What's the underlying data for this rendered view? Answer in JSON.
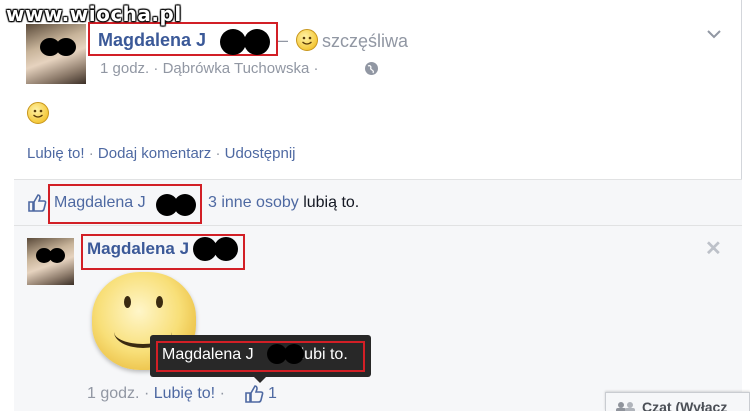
{
  "watermark": "www.wiocha.pl",
  "post": {
    "author": "Magdalena J",
    "feeling_dash": "–",
    "feeling": "szczęśliwa",
    "time": "1 godz.",
    "separator": "·",
    "location": "Dąbrówka Tuchowska",
    "location_sep": "·",
    "actions": {
      "like": "Lubię to!",
      "comment": "Dodaj komentarz",
      "share": "Udostępnij",
      "sep": "·"
    }
  },
  "likes": {
    "name": "Magdalena J",
    "others": "3 inne osoby",
    "suffix": "lubią to."
  },
  "comment": {
    "author": "Magdalena J",
    "close": "✕",
    "time": "1 godz.",
    "sep": "·",
    "like_action": "Lubię to!",
    "like_count": "1"
  },
  "tooltip": {
    "name": "Magdalena J",
    "suffix": "lubi to."
  },
  "chat": {
    "label": "Czat (Wyłącz"
  },
  "icons": {
    "chevron": "chevron-down-icon",
    "globe": "globe-icon",
    "thumb": "thumbs-up-icon",
    "close": "close-icon",
    "smiley": "smiley-icon"
  },
  "colors": {
    "link": "#4e69a2",
    "name": "#3b5998",
    "muted": "#9197a3",
    "highlight": "#d21f26"
  }
}
